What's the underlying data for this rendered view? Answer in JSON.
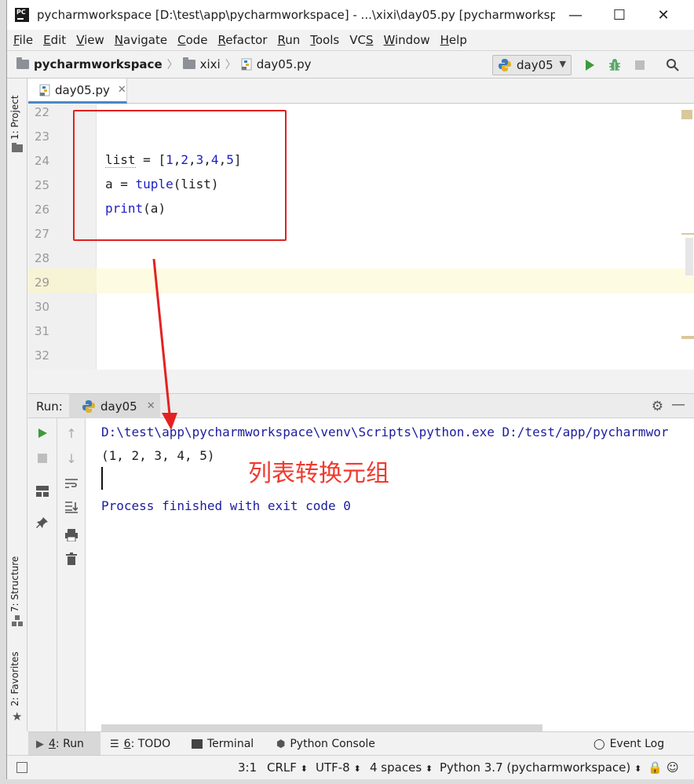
{
  "window": {
    "title": "pycharmworkspace [D:\\test\\app\\pycharmworkspace] - ...\\xixi\\day05.py [pycharmworksp...",
    "minimize": "—",
    "maximize": "☐",
    "close": "✕"
  },
  "menu": [
    {
      "u": "F",
      "rest": "ile"
    },
    {
      "u": "E",
      "rest": "dit"
    },
    {
      "u": "V",
      "rest": "iew"
    },
    {
      "u": "N",
      "rest": "avigate"
    },
    {
      "u": "C",
      "rest": "ode"
    },
    {
      "u": "R",
      "rest": "efactor"
    },
    {
      "u": "R",
      "rest": "un",
      "pre": ""
    },
    {
      "u": "T",
      "rest": "ools"
    },
    {
      "u": "S",
      "rest": "",
      "pre": "VC"
    },
    {
      "u": "W",
      "rest": "indow"
    },
    {
      "u": "H",
      "rest": "elp"
    }
  ],
  "breadcrumb": {
    "project": "pycharmworkspace",
    "folder": "xixi",
    "file": "day05.py"
  },
  "run_config": {
    "label": "day05"
  },
  "left_strip": {
    "project_tab": "1: Project",
    "structure_tab": "7: Structure",
    "favorites_tab": "2: Favorites"
  },
  "editor": {
    "tab_label": "day05.py",
    "lines": [
      {
        "n": "22",
        "code": ""
      },
      {
        "n": "23",
        "code": ""
      },
      {
        "n": "24",
        "code": "list"
      },
      {
        "n": "25",
        "code": ""
      },
      {
        "n": "26",
        "code": ""
      },
      {
        "n": "27",
        "code": ""
      },
      {
        "n": "28",
        "code": ""
      },
      {
        "n": "29",
        "code": ""
      },
      {
        "n": "30",
        "code": ""
      },
      {
        "n": "31",
        "code": ""
      },
      {
        "n": "32",
        "code": ""
      }
    ],
    "code": {
      "l24_a": "list",
      "l24_b": "= [",
      "l24_n1": "1",
      "l24_n2": "2",
      "l24_n3": "3",
      "l24_n4": "4",
      "l24_n5": "5",
      "l24_c": "]",
      "l25_a": "a = ",
      "l25_fn": "tuple",
      "l25_b": "(list)",
      "l26_fn": "print",
      "l26_b": "(a)"
    }
  },
  "run": {
    "label": "Run:",
    "tab_label": "day05",
    "console": {
      "cmd": "D:\\test\\app\\pycharmworkspace\\venv\\Scripts\\python.exe D:/test/app/pycharmwor",
      "output": "(1, 2, 3, 4, 5)",
      "exit": "Process finished with exit code 0"
    },
    "annotation": "列表转换元组"
  },
  "bottom_tabs": {
    "run": {
      "u": "4",
      "rest": ": Run"
    },
    "todo": {
      "u": "6",
      "rest": ": TODO"
    },
    "terminal": "Terminal",
    "python_console": "Python Console",
    "event_log": "Event Log"
  },
  "status": {
    "position": "3:1",
    "line_sep": "CRLF",
    "encoding": "UTF-8",
    "indent": "4 spaces",
    "interpreter": "Python 3.7 (pycharmworkspace)"
  },
  "colors": {
    "annotation_red": "#f03a2e",
    "run_green": "#3c9b3c",
    "number_blue": "#1c1cc6"
  }
}
